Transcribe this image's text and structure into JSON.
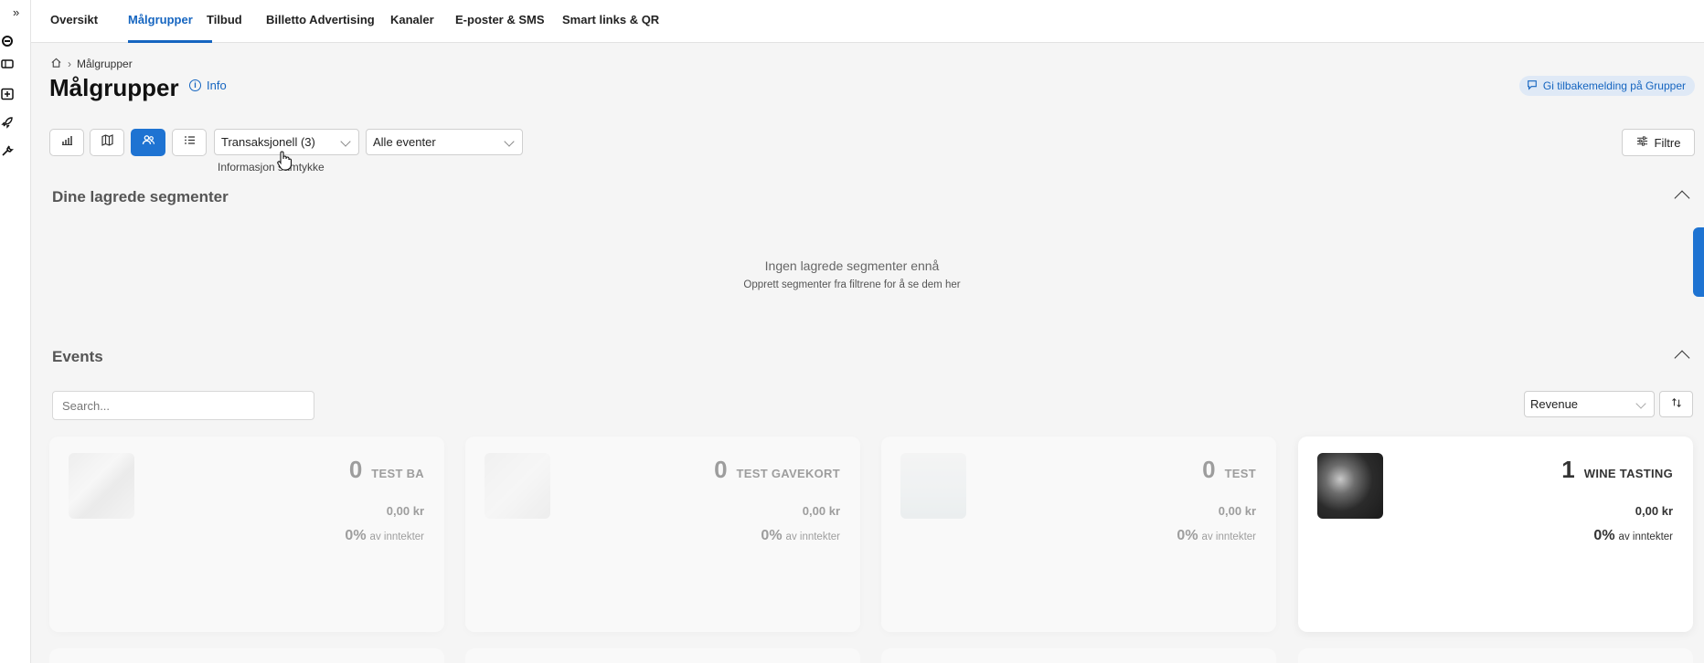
{
  "topnav": {
    "tabs": [
      {
        "label": "Oversikt",
        "active": false
      },
      {
        "label": "Målgrupper",
        "active": true
      },
      {
        "label": "Tilbud",
        "active": false
      },
      {
        "label": "Billetto Advertising",
        "active": false
      },
      {
        "label": "Kanaler",
        "active": false
      },
      {
        "label": "E-poster & SMS",
        "active": false
      },
      {
        "label": "Smart links & QR",
        "active": false
      }
    ]
  },
  "breadcrumb": {
    "current": "Målgrupper"
  },
  "header": {
    "title": "Målgrupper",
    "info_label": "Info",
    "feedback_label": "Gi tilbakemelding på Grupper"
  },
  "toolbar": {
    "consent_select": "Transaksjonell (3)",
    "event_select": "Alle eventer",
    "hover_hint": "Informasjon samtykke",
    "filter_label": "Filtre"
  },
  "segments": {
    "title": "Dine lagrede segmenter",
    "empty_title": "Ingen lagrede segmenter ennå",
    "empty_subtitle": "Opprett segmenter fra filtrene for å se dem her"
  },
  "events": {
    "title": "Events",
    "search_placeholder": "Search...",
    "sort_value": "Revenue",
    "cards": [
      {
        "count": "0",
        "name": "TEST BA",
        "revenue": "0,00 kr",
        "share": "0%",
        "share_label": "av inntekter",
        "dimmed": true
      },
      {
        "count": "0",
        "name": "TEST GAVEKORT",
        "revenue": "0,00 kr",
        "share": "0%",
        "share_label": "av inntekter",
        "dimmed": true
      },
      {
        "count": "0",
        "name": "TEST",
        "revenue": "0,00 kr",
        "share": "0%",
        "share_label": "av inntekter",
        "dimmed": true
      },
      {
        "count": "1",
        "name": "WINE TASTING",
        "revenue": "0,00 kr",
        "share": "0%",
        "share_label": "av inntekter",
        "dimmed": false
      }
    ]
  },
  "colors": {
    "accent": "#1565c0",
    "active_button": "#1e73d2",
    "feedback_bg": "#dfe9f6",
    "page_bg": "#f5f5f5"
  }
}
